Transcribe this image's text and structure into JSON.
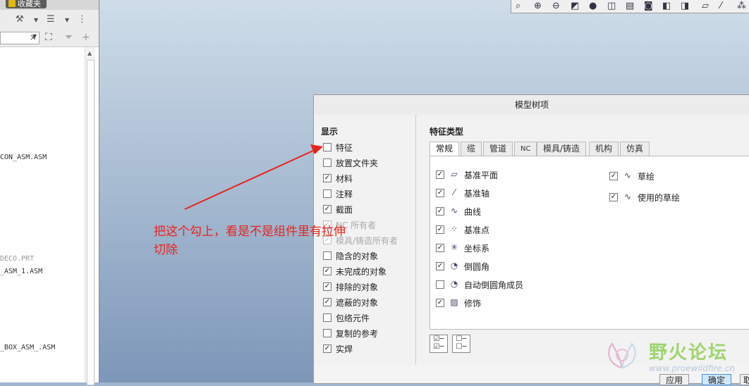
{
  "sidebar": {
    "fav_tab": "收藏夹",
    "search_clear": "×",
    "tree_items": [
      "CON_ASM.ASM",
      "DECO.PRT",
      "_ASM_1.ASM",
      "_BOX_ASM_.ASM"
    ]
  },
  "dialog": {
    "title": "模型树项",
    "show_section": {
      "title": "显示",
      "items": [
        {
          "label": "特征",
          "checked": false,
          "disabled": false
        },
        {
          "label": "放置文件夹",
          "checked": false,
          "disabled": false
        },
        {
          "label": "材料",
          "checked": true,
          "disabled": false
        },
        {
          "label": "注释",
          "checked": false,
          "disabled": false
        },
        {
          "label": "截面",
          "checked": true,
          "disabled": false
        },
        {
          "label": "NC 所有者",
          "checked": true,
          "disabled": true
        },
        {
          "label": "模具/铸造所有者",
          "checked": true,
          "disabled": true
        },
        {
          "label": "隐含的对象",
          "checked": false,
          "disabled": false
        },
        {
          "label": "未完成的对象",
          "checked": true,
          "disabled": false
        },
        {
          "label": "排除的对象",
          "checked": true,
          "disabled": false
        },
        {
          "label": "遮蔽的对象",
          "checked": true,
          "disabled": false
        },
        {
          "label": "包络元件",
          "checked": false,
          "disabled": false
        },
        {
          "label": "复制的参考",
          "checked": false,
          "disabled": false
        },
        {
          "label": "实焊",
          "checked": true,
          "disabled": false
        }
      ]
    },
    "type_section": {
      "title": "特征类型",
      "tabs": [
        "常规",
        "缆",
        "管道",
        "NC",
        "模具/铸造",
        "机构",
        "仿真"
      ],
      "active_tab": "常规",
      "left_items": [
        {
          "label": "基准平面",
          "checked": true,
          "icon": "datum-plane-icon"
        },
        {
          "label": "基准轴",
          "checked": true,
          "icon": "datum-axis-icon"
        },
        {
          "label": "曲线",
          "checked": true,
          "icon": "curve-icon"
        },
        {
          "label": "基准点",
          "checked": true,
          "icon": "datum-point-icon"
        },
        {
          "label": "坐标系",
          "checked": true,
          "icon": "coordinate-system-icon"
        },
        {
          "label": "倒圆角",
          "checked": true,
          "icon": "round-icon"
        },
        {
          "label": "自动倒圆角成员",
          "checked": false,
          "icon": "auto-round-icon"
        },
        {
          "label": "修饰",
          "checked": true,
          "icon": "cosmetic-icon"
        }
      ],
      "right_items": [
        {
          "label": "草绘",
          "checked": true,
          "icon": "sketch-icon"
        },
        {
          "label": "使用的草绘",
          "checked": true,
          "icon": "used-sketch-icon"
        }
      ]
    },
    "footer": {
      "apply": "应用",
      "ok": "确定",
      "cancel_partial": "取"
    }
  },
  "annotation": {
    "text": "把这个勾上，看是不是组件里有拉伸切除",
    "color": "#e8231c"
  },
  "watermark": {
    "title": "野火论坛",
    "url": "www.proewildfire.cn"
  }
}
